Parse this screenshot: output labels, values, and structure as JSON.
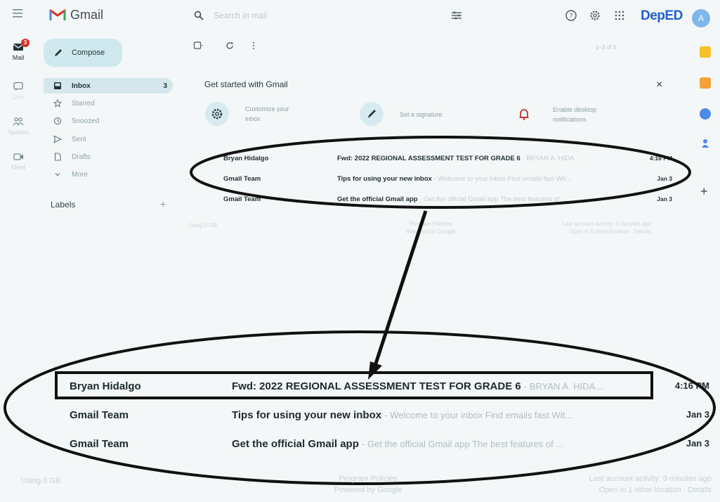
{
  "app": {
    "name": "Gmail",
    "brand": "DepED",
    "brand_color": "#1f5fcf",
    "brand_accent": "#d93025"
  },
  "search": {
    "placeholder": "Search in mail"
  },
  "account": {
    "initial": "A"
  },
  "rail": {
    "items": [
      {
        "label": "Mail",
        "icon": "mail-icon",
        "badge": "3"
      },
      {
        "label": "Chat",
        "icon": "chat-icon"
      },
      {
        "label": "Spaces",
        "icon": "spaces-icon"
      },
      {
        "label": "Meet",
        "icon": "meet-icon"
      }
    ]
  },
  "compose": {
    "label": "Compose"
  },
  "nav": {
    "items": [
      {
        "label": "Inbox",
        "icon": "inbox-icon",
        "count": "3"
      },
      {
        "label": "Starred",
        "icon": "star-icon"
      },
      {
        "label": "Snoozed",
        "icon": "clock-icon"
      },
      {
        "label": "Sent",
        "icon": "send-icon"
      },
      {
        "label": "Drafts",
        "icon": "draft-icon"
      },
      {
        "label": "More",
        "icon": "chevron-down-icon"
      }
    ]
  },
  "labels": {
    "title": "Labels",
    "add": "+"
  },
  "toolbar": {
    "page_info": "1–3 of 3"
  },
  "get_started": {
    "title": "Get started with Gmail",
    "close": "×",
    "actions": [
      {
        "label_line1": "Customize your",
        "label_line2": "inbox",
        "icon": "gear-icon"
      },
      {
        "label_line1": "Set a signature",
        "label_line2": "",
        "icon": "pen-icon"
      },
      {
        "label_line1": "Enable desktop",
        "label_line2": "notifications",
        "icon": "bell-icon"
      }
    ]
  },
  "emails": [
    {
      "sender": "Bryan Hidalgo",
      "subject": "Fwd: 2022 REGIONAL ASSESSMENT TEST FOR GRADE 6",
      "snippet": "BRYAN A. HIDA...",
      "date": "4:16 PM"
    },
    {
      "sender": "Gmail Team",
      "subject": "Tips for using your new inbox",
      "snippet": "Welcome to your inbox Find emails fast Wit...",
      "date": "Jan 3"
    },
    {
      "sender": "Gmail Team",
      "subject": "Get the official Gmail app",
      "snippet": "Get the official Gmail app The best features of ...",
      "date": "Jan 3"
    }
  ],
  "footer": {
    "storage": "Using 0 GB",
    "policies": "Program Policies",
    "powered": "Powered by Google",
    "activity": "Last account activity: 0 minutes ago",
    "location": "Open in 1 other location · Details"
  },
  "colors": {
    "background": "#f4f7f7",
    "compose_bg": "#cfe8ee",
    "nav_active_bg": "#d5e7ec",
    "annotation": "#111111"
  }
}
